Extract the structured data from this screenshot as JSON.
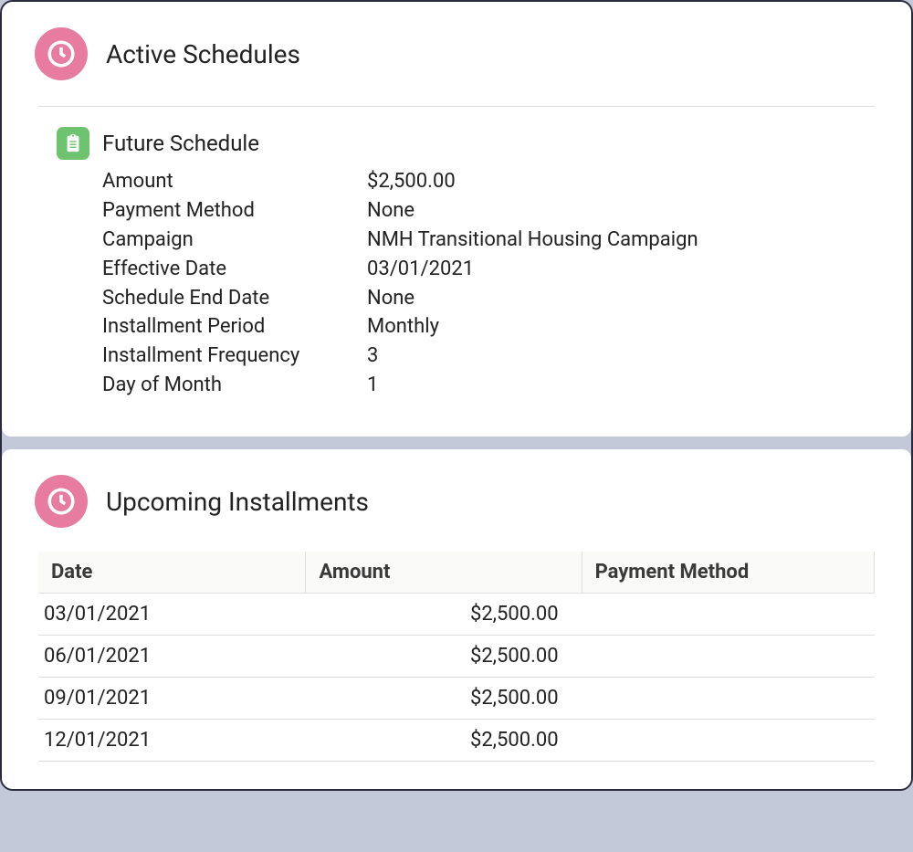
{
  "icons": {
    "clock": "clock-icon",
    "clipboard": "clipboard-icon"
  },
  "colors": {
    "accent_pink": "#e87ba0",
    "accent_green": "#6ec370"
  },
  "active_schedules": {
    "title": "Active Schedules",
    "schedule": {
      "title": "Future Schedule",
      "labels": {
        "amount": "Amount",
        "payment_method": "Payment Method",
        "campaign": "Campaign",
        "effective_date": "Effective Date",
        "schedule_end_date": "Schedule End Date",
        "installment_period": "Installment Period",
        "installment_frequency": "Installment Frequency",
        "day_of_month": "Day of Month"
      },
      "values": {
        "amount": "$2,500.00",
        "payment_method": "None",
        "campaign": "NMH Transitional Housing Campaign",
        "effective_date": "03/01/2021",
        "schedule_end_date": "None",
        "installment_period": "Monthly",
        "installment_frequency": "3",
        "day_of_month": "1"
      }
    }
  },
  "upcoming_installments": {
    "title": "Upcoming Installments",
    "columns": {
      "date": "Date",
      "amount": "Amount",
      "payment_method": "Payment Method"
    },
    "rows": [
      {
        "date": "03/01/2021",
        "amount": "$2,500.00",
        "payment_method": ""
      },
      {
        "date": "06/01/2021",
        "amount": "$2,500.00",
        "payment_method": ""
      },
      {
        "date": "09/01/2021",
        "amount": "$2,500.00",
        "payment_method": ""
      },
      {
        "date": "12/01/2021",
        "amount": "$2,500.00",
        "payment_method": ""
      }
    ]
  }
}
